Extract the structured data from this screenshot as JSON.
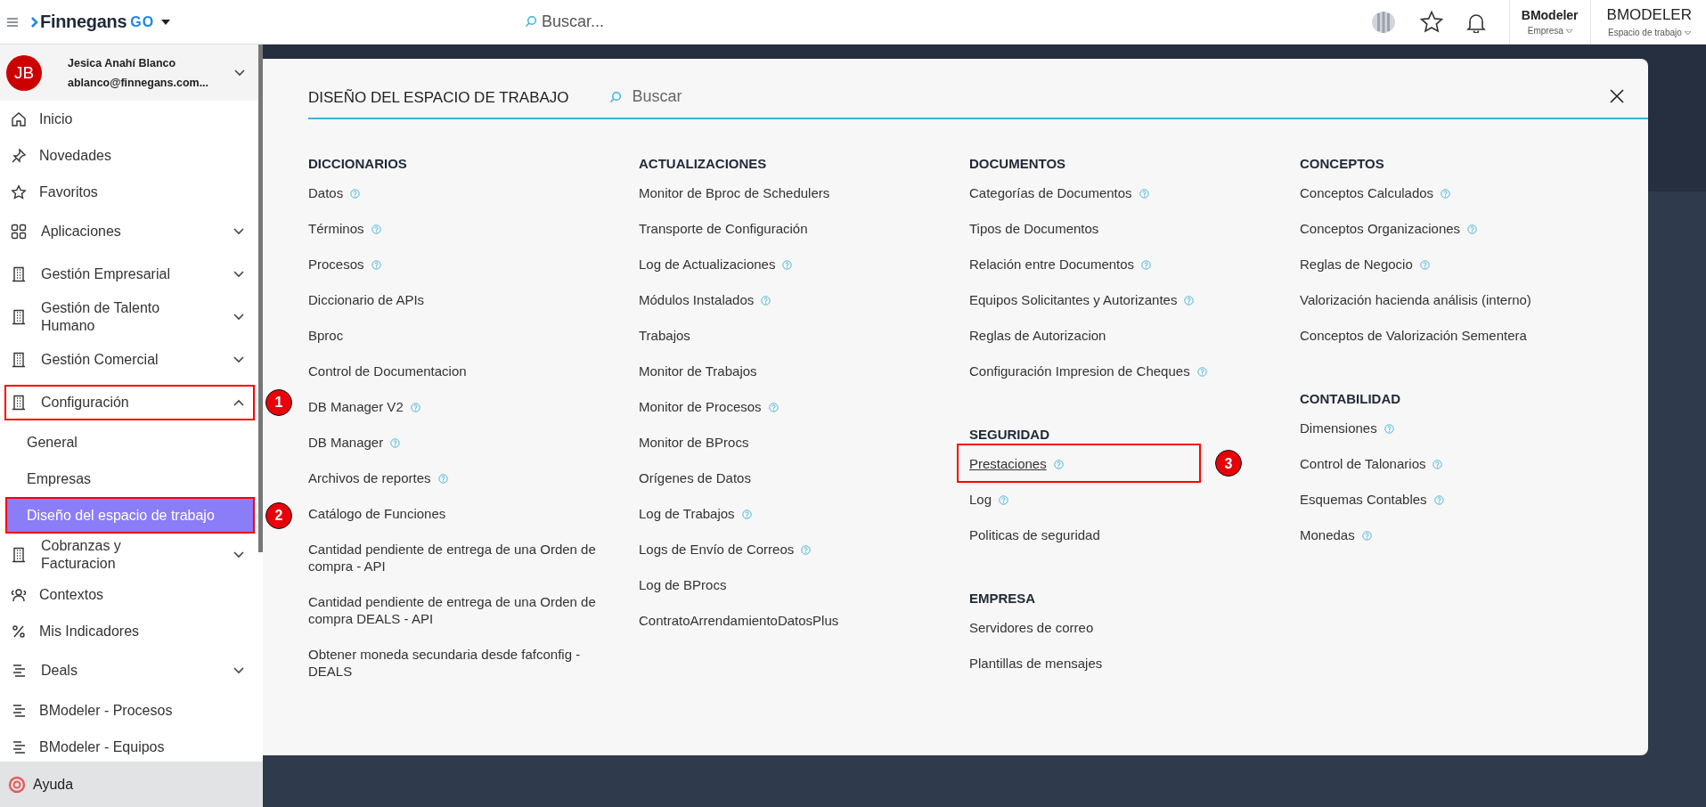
{
  "topbar": {
    "logo": {
      "name": "Finnegans",
      "suffix": "GO"
    },
    "search": {
      "placeholder": "Buscar..."
    },
    "company": {
      "value": "BModeler",
      "label": "Empresa"
    },
    "workspace": {
      "value": "BMODELER",
      "label": "Espacio de trabajo"
    }
  },
  "user": {
    "initials": "JB",
    "name": "Jesica Anahí Blanco",
    "email": "ablanco@finnegans.com..."
  },
  "sidebar": {
    "items": [
      {
        "label": "Inicio",
        "kind": "link",
        "selected": false
      },
      {
        "label": "Novedades",
        "kind": "link",
        "selected": false
      },
      {
        "label": "Favoritos",
        "kind": "link",
        "selected": false
      },
      {
        "label": "Aplicaciones",
        "kind": "group",
        "expanded": false,
        "selected": false
      },
      {
        "label": "Gestión Empresarial",
        "kind": "group",
        "expanded": false,
        "selected": false
      },
      {
        "label": "Gestión de Talento Humano",
        "kind": "group",
        "expanded": false,
        "selected": false
      },
      {
        "label": "Gestión Comercial",
        "kind": "group",
        "expanded": false,
        "selected": false
      },
      {
        "label": "Configuración",
        "kind": "group",
        "expanded": true,
        "selected": false,
        "callout": "1"
      },
      {
        "label": "General",
        "kind": "sub",
        "selected": false
      },
      {
        "label": "Empresas",
        "kind": "sub",
        "selected": false
      },
      {
        "label": "Diseño del espacio de trabajo",
        "kind": "sub",
        "selected": true,
        "callout": "2"
      },
      {
        "label": "Cobranzas y Facturacion",
        "kind": "group",
        "expanded": false,
        "selected": false
      },
      {
        "label": "Contextos",
        "kind": "link",
        "selected": false
      },
      {
        "label": "Mis Indicadores",
        "kind": "link",
        "selected": false
      },
      {
        "label": "Deals",
        "kind": "group",
        "expanded": false,
        "selected": false
      },
      {
        "label": "BModeler - Procesos",
        "kind": "link",
        "selected": false
      },
      {
        "label": "BModeler - Equipos",
        "kind": "link",
        "selected": false
      }
    ],
    "help": {
      "label": "Ayuda"
    }
  },
  "modal": {
    "title": "DISEÑO DEL ESPACIO DE TRABAJO",
    "search": {
      "placeholder": "Buscar"
    },
    "columns": [
      {
        "sections": [
          {
            "title": "DICCIONARIOS",
            "items": [
              {
                "label": "Datos",
                "help": true,
                "hovered": false
              },
              {
                "label": "Términos",
                "help": true,
                "hovered": false
              },
              {
                "label": "Procesos",
                "help": true,
                "hovered": false
              },
              {
                "label": "Diccionario de APIs",
                "help": false,
                "hovered": false
              },
              {
                "label": "Bproc",
                "help": false,
                "hovered": false
              },
              {
                "label": "Control de Documentacion",
                "help": false,
                "hovered": false
              },
              {
                "label": "DB Manager V2",
                "help": true,
                "hovered": false
              },
              {
                "label": "DB Manager",
                "help": true,
                "hovered": false
              },
              {
                "label": "Archivos de reportes",
                "help": true,
                "hovered": false
              },
              {
                "label": "Catálogo de Funciones",
                "help": false,
                "hovered": false
              },
              {
                "label": "Cantidad pendiente de entrega de una Orden de compra - API",
                "help": false,
                "hovered": false
              },
              {
                "label": "Cantidad pendiente de entrega de una Orden de compra DEALS - API",
                "help": false,
                "hovered": false
              },
              {
                "label": "Obtener moneda secundaria desde fafconfig - DEALS",
                "help": false,
                "hovered": false
              }
            ]
          }
        ]
      },
      {
        "sections": [
          {
            "title": "ACTUALIZACIONES",
            "items": [
              {
                "label": "Monitor de Bproc de Schedulers",
                "help": false,
                "hovered": false
              },
              {
                "label": "Transporte de Configuración",
                "help": false,
                "hovered": false
              },
              {
                "label": "Log de Actualizaciones",
                "help": true,
                "hovered": false
              },
              {
                "label": "Módulos Instalados",
                "help": true,
                "hovered": false
              },
              {
                "label": "Trabajos",
                "help": false,
                "hovered": false
              },
              {
                "label": "Monitor de Trabajos",
                "help": false,
                "hovered": false
              },
              {
                "label": "Monitor de Procesos",
                "help": true,
                "hovered": false
              },
              {
                "label": "Monitor de BProcs",
                "help": false,
                "hovered": false
              },
              {
                "label": "Orígenes de Datos",
                "help": false,
                "hovered": false
              },
              {
                "label": "Log de Trabajos",
                "help": true,
                "hovered": false
              },
              {
                "label": "Logs de Envío de Correos",
                "help": true,
                "hovered": false
              },
              {
                "label": "Log de BProcs",
                "help": false,
                "hovered": false
              },
              {
                "label": "ContratoArrendamientoDatosPlus",
                "help": false,
                "hovered": false
              }
            ]
          }
        ]
      },
      {
        "sections": [
          {
            "title": "DOCUMENTOS",
            "items": [
              {
                "label": "Categorías de Documentos",
                "help": true,
                "hovered": false
              },
              {
                "label": "Tipos de Documentos",
                "help": false,
                "hovered": false
              },
              {
                "label": "Relación entre Documentos",
                "help": true,
                "hovered": false
              },
              {
                "label": "Equipos Solicitantes y Autorizantes",
                "help": true,
                "hovered": false
              },
              {
                "label": "Reglas de Autorizacion",
                "help": false,
                "hovered": false
              },
              {
                "label": "Configuración Impresion de Cheques",
                "help": true,
                "hovered": false
              }
            ]
          },
          {
            "title": "SEGURIDAD",
            "items": [
              {
                "label": "Prestaciones",
                "help": true,
                "hovered": true,
                "callout": "3"
              },
              {
                "label": "Log",
                "help": true,
                "hovered": false
              },
              {
                "label": "Politicas de seguridad",
                "help": false,
                "hovered": false
              }
            ]
          },
          {
            "title": "EMPRESA",
            "items": [
              {
                "label": "Servidores de correo",
                "help": false,
                "hovered": false
              },
              {
                "label": "Plantillas de mensajes",
                "help": false,
                "hovered": false
              }
            ]
          }
        ]
      },
      {
        "sections": [
          {
            "title": "CONCEPTOS",
            "items": [
              {
                "label": "Conceptos Calculados",
                "help": true,
                "hovered": false
              },
              {
                "label": "Conceptos Organizaciones",
                "help": true,
                "hovered": false
              },
              {
                "label": "Reglas de Negocio",
                "help": true,
                "hovered": false
              },
              {
                "label": "Valorización hacienda análisis (interno)",
                "help": false,
                "hovered": false
              },
              {
                "label": "Conceptos de Valorización Sementera",
                "help": false,
                "hovered": false
              }
            ]
          },
          {
            "title": "CONTABILIDAD",
            "items": [
              {
                "label": "Dimensiones",
                "help": true,
                "hovered": false
              },
              {
                "label": "Control de Talonarios",
                "help": true,
                "hovered": false
              },
              {
                "label": "Esquemas Contables",
                "help": true,
                "hovered": false
              },
              {
                "label": "Monedas",
                "help": true,
                "hovered": false
              }
            ]
          }
        ]
      }
    ]
  }
}
